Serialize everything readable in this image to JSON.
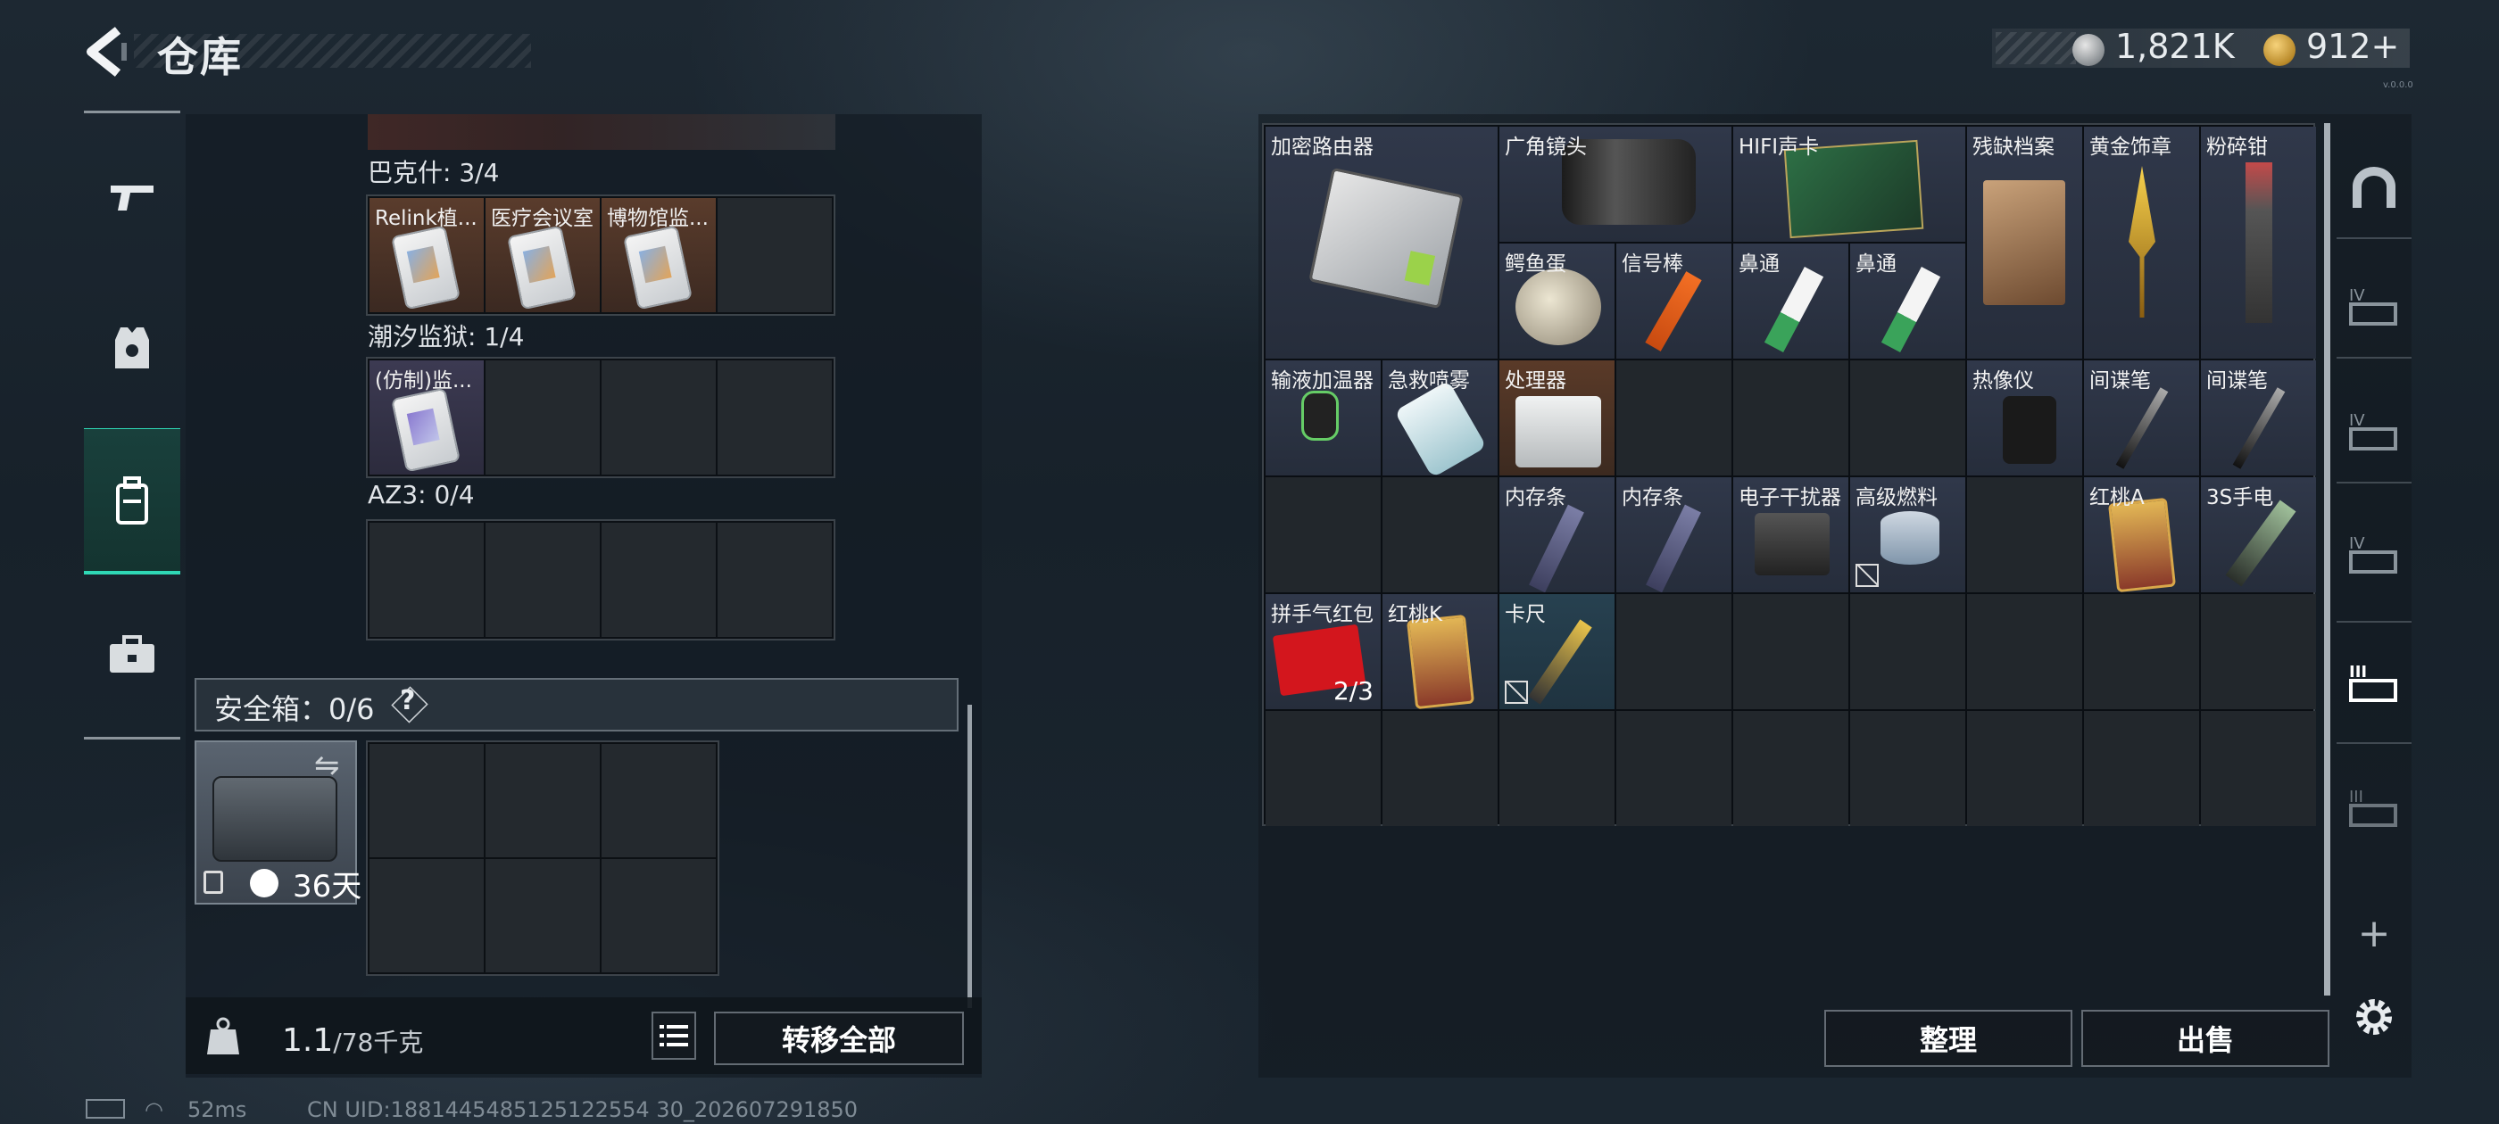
{
  "header": {
    "title": "仓库",
    "silver": "1,821K",
    "gold": "912+",
    "version": "v.0.0.0"
  },
  "left_nav": [
    {
      "name": "weapons",
      "icon": "gun-icon"
    },
    {
      "name": "armor",
      "icon": "vest-icon"
    },
    {
      "name": "backpack",
      "icon": "backpack-icon",
      "active": true
    },
    {
      "name": "cases",
      "icon": "briefcase-icon"
    }
  ],
  "left": {
    "groups": [
      {
        "label": "巴克什: 3/4",
        "items": [
          {
            "name": "Relink植...",
            "rarity": "brown"
          },
          {
            "name": "医疗会议室",
            "rarity": "brown"
          },
          {
            "name": "博物馆监...",
            "rarity": "brown"
          },
          null
        ]
      },
      {
        "label": "潮汐监狱: 1/4",
        "items": [
          {
            "name": "(仿制)监...",
            "rarity": "purple"
          },
          null,
          null,
          null
        ]
      },
      {
        "label": "AZ3: 0/4",
        "items": [
          null,
          null,
          null,
          null
        ]
      }
    ],
    "safe_box": {
      "label": "安全箱：0/6",
      "help": "?",
      "days": "36天"
    },
    "weight": {
      "current": "1.1",
      "max": "/78千克"
    },
    "transfer_all": "转移全部"
  },
  "right": {
    "items": [
      {
        "name": "加密路由器",
        "r": 1,
        "c": 1,
        "rs": 2,
        "cs": 2,
        "color": "slate",
        "art": "router"
      },
      {
        "name": "广角镜头",
        "r": 1,
        "c": 3,
        "rs": 1,
        "cs": 2,
        "color": "slate",
        "art": "lens"
      },
      {
        "name": "HIFI声卡",
        "r": 1,
        "c": 5,
        "rs": 1,
        "cs": 2,
        "color": "slate",
        "art": "card"
      },
      {
        "name": "残缺档案",
        "r": 1,
        "c": 7,
        "rs": 2,
        "cs": 1,
        "color": "slate",
        "art": "paper"
      },
      {
        "name": "黄金饰章",
        "r": 1,
        "c": 8,
        "rs": 2,
        "cs": 1,
        "color": "slate",
        "art": "gold"
      },
      {
        "name": "粉碎钳",
        "r": 1,
        "c": 9,
        "rs": 2,
        "cs": 1,
        "color": "slate",
        "art": "plier"
      },
      {
        "name": "鳄鱼蛋",
        "r": 2,
        "c": 3,
        "color": "slate",
        "art": "egg"
      },
      {
        "name": "信号棒",
        "r": 2,
        "c": 4,
        "color": "slate",
        "art": "flare"
      },
      {
        "name": "鼻通",
        "r": 2,
        "c": 5,
        "color": "slate",
        "art": "tube"
      },
      {
        "name": "鼻通",
        "r": 2,
        "c": 6,
        "color": "slate",
        "art": "tube"
      },
      {
        "name": "输液加温器",
        "r": 3,
        "c": 1,
        "color": "slate",
        "art": "warmer"
      },
      {
        "name": "急救喷雾",
        "r": 3,
        "c": 2,
        "color": "slate",
        "art": "spray"
      },
      {
        "name": "处理器",
        "r": 3,
        "c": 3,
        "color": "orange",
        "art": "cpu"
      },
      {
        "name": "热像仪",
        "r": 3,
        "c": 7,
        "color": "slate",
        "art": "thermal"
      },
      {
        "name": "间谍笔",
        "r": 3,
        "c": 8,
        "color": "slate",
        "art": "pen"
      },
      {
        "name": "间谍笔",
        "r": 3,
        "c": 9,
        "color": "slate",
        "art": "pen"
      },
      {
        "name": "内存条",
        "r": 4,
        "c": 3,
        "color": "slate",
        "art": "ram"
      },
      {
        "name": "内存条",
        "r": 4,
        "c": 4,
        "color": "slate",
        "art": "ram"
      },
      {
        "name": "电子干扰器",
        "r": 4,
        "c": 5,
        "color": "slate",
        "art": "jammer"
      },
      {
        "name": "高级燃料",
        "r": 4,
        "c": 6,
        "color": "slate",
        "art": "can",
        "no_sell": true
      },
      {
        "name": "红桃A",
        "r": 4,
        "c": 8,
        "color": "slate",
        "art": "tarot"
      },
      {
        "name": "3S手电",
        "r": 4,
        "c": 9,
        "color": "slate",
        "art": "torch"
      },
      {
        "name": "拼手气红包",
        "r": 5,
        "c": 1,
        "color": "slate",
        "art": "envelope",
        "count": "2/3"
      },
      {
        "name": "红桃K",
        "r": 5,
        "c": 2,
        "color": "slate",
        "art": "tarot"
      },
      {
        "name": "卡尺",
        "r": 5,
        "c": 3,
        "color": "teal",
        "art": "caliper",
        "no_sell": true
      }
    ],
    "sort_label": "整理",
    "sell_label": "出售"
  },
  "right_nav": [
    {
      "name": "safe-zone",
      "icon": "arch-icon"
    },
    {
      "name": "storage-4a",
      "icon": "stash-iv-icon",
      "label": "IV"
    },
    {
      "name": "storage-4b",
      "icon": "stash-iv-icon",
      "label": "IV"
    },
    {
      "name": "storage-4c",
      "icon": "stash-iv-icon",
      "label": "IV"
    },
    {
      "name": "storage-3-active",
      "icon": "stash-iii-icon",
      "label": "III"
    },
    {
      "name": "storage-3",
      "icon": "stash-iii-icon",
      "label": "III"
    },
    {
      "name": "add",
      "icon": "plus-icon",
      "label": "+"
    },
    {
      "name": "settings",
      "icon": "gear-icon"
    }
  ],
  "status": {
    "ping": "52ms",
    "uid": "CN UID:1881445485125122554 30_202607291850"
  }
}
